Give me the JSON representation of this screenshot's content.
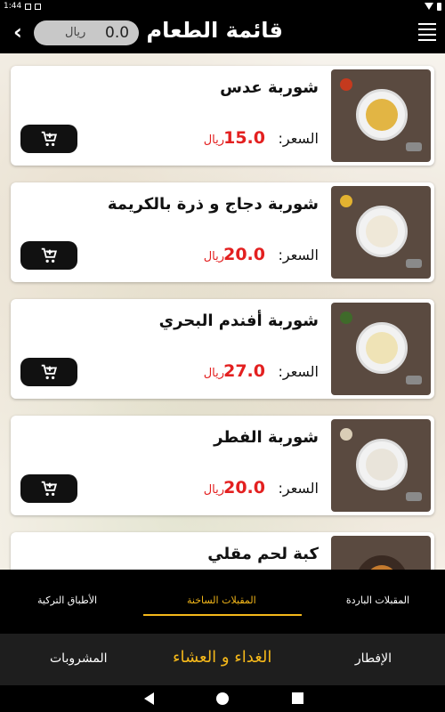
{
  "status_bar": {
    "time": "1:44"
  },
  "app_bar": {
    "title": "قائمة الطعام",
    "cart_amount": "0.0",
    "cart_currency": "ريال"
  },
  "menu_items": [
    {
      "name": "شوربة عدس",
      "price_label": "السعر:",
      "price": "15.0",
      "currency": "ريال",
      "soup_color": "#e2b544"
    },
    {
      "name": "شوربة دجاج و ذرة بالكريمة",
      "price_label": "السعر:",
      "price": "20.0",
      "currency": "ريال",
      "soup_color": "#efe8d8"
    },
    {
      "name": "شوربة أفندم البحري",
      "price_label": "السعر:",
      "price": "27.0",
      "currency": "ريال",
      "soup_color": "#efe3b6"
    },
    {
      "name": "شوربة الفطر",
      "price_label": "السعر:",
      "price": "20.0",
      "currency": "ريال",
      "soup_color": "#e9e4da"
    },
    {
      "name": "كبة لحم مقلي",
      "price_label": "",
      "price": "",
      "currency": "",
      "soup_color": "#c47a2e"
    }
  ],
  "category_tabs": [
    {
      "label": "المقبلات الباردة",
      "active": false
    },
    {
      "label": "المقبلات الساخنة",
      "active": true
    },
    {
      "label": "الأطباق التركية",
      "active": false
    }
  ],
  "section_tabs": [
    {
      "label": "الإفطار",
      "active": false
    },
    {
      "label": "الغداء و العشاء",
      "active": true
    },
    {
      "label": "المشروبات",
      "active": false
    }
  ],
  "colors": {
    "accent": "#f5b81a",
    "price": "#e32020",
    "header_bg": "#000000"
  },
  "icons": [
    "back-arrow-icon",
    "menu-icon",
    "add-to-cart-icon",
    "wifi-icon",
    "battery-icon"
  ]
}
